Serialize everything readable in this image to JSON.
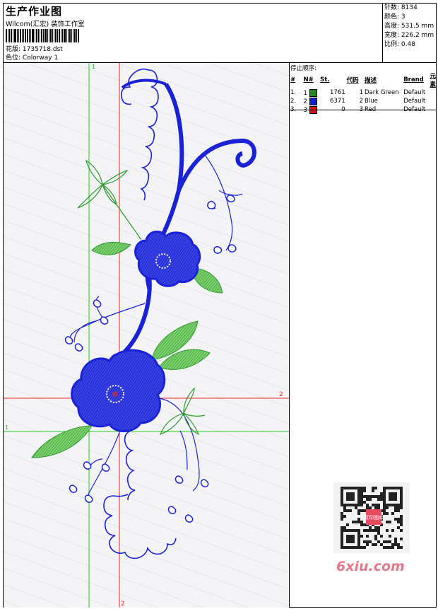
{
  "header": {
    "title": "生产作业图",
    "company": "Wilcom(汇宏) 装饰工作室",
    "file_label": "花版:",
    "file_name": "1735718.dst",
    "color_label": "色位:",
    "color_name": "Colorway 1"
  },
  "stats": {
    "stitches_label": "针数:",
    "stitches": "8134",
    "colors_label": "颜色:",
    "colors": "3",
    "height_label": "高度:",
    "height": "531.5 mm",
    "width_label": "宽度:",
    "width": "226.2 mm",
    "ratio_label": "比例:",
    "ratio": "0.48"
  },
  "stop_sequence": {
    "title": "停止顺序:",
    "columns": [
      "#",
      "N#",
      "St.",
      "代码",
      "描述",
      "Brand",
      "元素"
    ],
    "rows": [
      {
        "idx": "1.",
        "n": "1",
        "color": "#1f8a1f",
        "st": "1761",
        "code": "1",
        "desc": "Dark Green",
        "brand": "Default"
      },
      {
        "idx": "2.",
        "n": "2",
        "color": "#1020d0",
        "st": "6371",
        "code": "2",
        "desc": "Blue",
        "brand": "Default"
      },
      {
        "idx": "3.",
        "n": "3",
        "color": "#e01010",
        "st": "0",
        "code": "3",
        "desc": "Red",
        "brand": "Default"
      }
    ]
  },
  "axes": {
    "green_top": "1",
    "green_left": "1",
    "red_right": "2",
    "red_bottom": "2"
  },
  "watermark": "6xiu.com",
  "qr_badge": "汉印图库",
  "colors": {
    "green_thread": "#2e9a2e",
    "blue_thread": "#1a22d8",
    "red_thread": "#e01010",
    "guide_green": "#22cc22",
    "guide_red": "#ee2222"
  }
}
